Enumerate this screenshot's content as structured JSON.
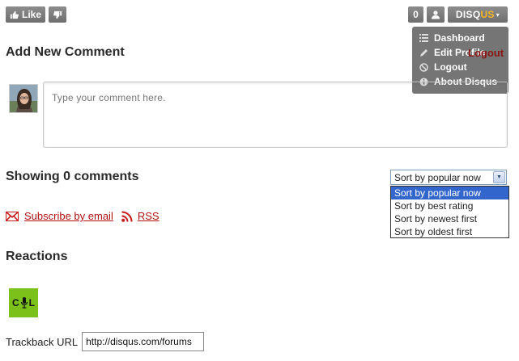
{
  "toolbar": {
    "like_label": "Like",
    "comment_count": "0",
    "brand_prefix": "DISQ",
    "brand_suffix": "US",
    "brand_caret": "▾"
  },
  "user_menu": {
    "items": [
      {
        "label": "Dashboard",
        "icon": "list-icon"
      },
      {
        "label": "Edit Profile",
        "icon": "pencil-icon"
      },
      {
        "label": "Logout",
        "icon": "no-entry-icon"
      },
      {
        "label": "About Disqus",
        "icon": "info-icon"
      }
    ],
    "ghost_link": "Logout"
  },
  "comment_form": {
    "heading": "Add New Comment",
    "placeholder": "Type your comment here."
  },
  "comments": {
    "heading": "Showing 0 comments",
    "sort": {
      "selected": "Sort by popular now",
      "options": [
        "Sort by popular now",
        "Sort by best rating",
        "Sort by newest first",
        "Sort by oldest first"
      ]
    },
    "subscribe_label": "Subscribe by email",
    "rss_label": "RSS"
  },
  "reactions": {
    "heading": "Reactions",
    "logo_left": "C",
    "logo_right": "L"
  },
  "trackback": {
    "label": "Trackback URL",
    "value": "http://disqus.com/forums"
  },
  "colors": {
    "button_gray": "#7a7a7a",
    "brand_yellow": "#f6b81e",
    "link_red": "#b11010",
    "select_highlight": "#3366cc",
    "reaction_green": "#7cc11a"
  }
}
